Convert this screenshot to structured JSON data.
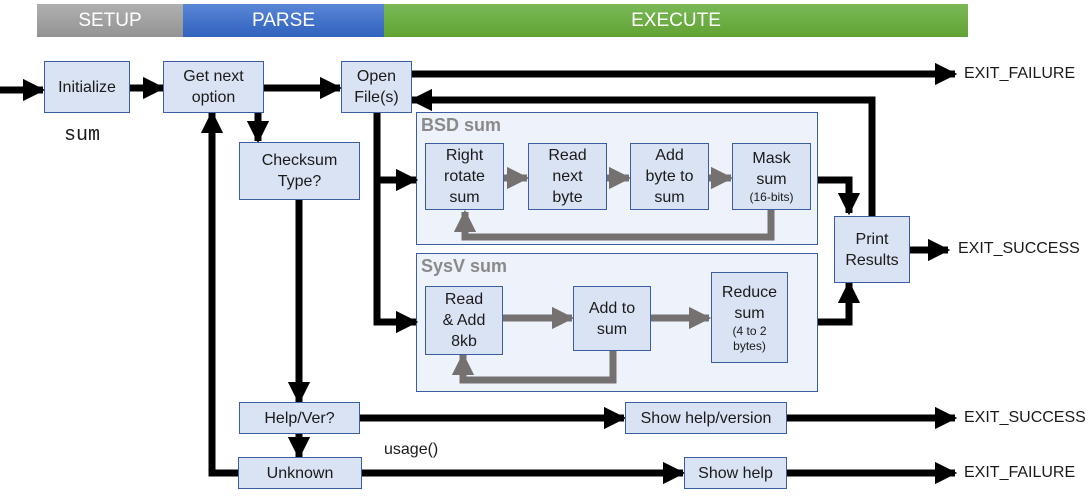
{
  "phases": [
    {
      "label": "SETUP",
      "color": "#a6a6a6"
    },
    {
      "label": "PARSE",
      "color": "#4472c4"
    },
    {
      "label": "EXECUTE",
      "color": "#70ad47"
    }
  ],
  "program_name": "sum",
  "nodes": {
    "initialize": "Initialize",
    "get_next_option": "Get next\noption",
    "open_files": "Open\nFile(s)",
    "checksum_type": "Checksum\nType?",
    "help_ver": "Help/Ver?",
    "unknown": "Unknown",
    "show_help_version": "Show help/version",
    "show_help": "Show help",
    "print_results": "Print\nResults"
  },
  "bsd_group": {
    "title": "BSD sum",
    "steps": [
      {
        "text": "Right\nrotate\nsum",
        "note": ""
      },
      {
        "text": "Read\nnext\nbyte",
        "note": ""
      },
      {
        "text": "Add\nbyte to\nsum",
        "note": ""
      },
      {
        "text": "Mask\nsum",
        "note": "(16-bits)"
      }
    ]
  },
  "sysv_group": {
    "title": "SysV sum",
    "steps": [
      {
        "text": "Read\n& Add\n8kb",
        "note": ""
      },
      {
        "text": "Add to\nsum",
        "note": ""
      },
      {
        "text": "Reduce\nsum",
        "note": "(4 to 2\nbytes)"
      }
    ]
  },
  "edge_labels": {
    "usage": "usage()"
  },
  "exits": {
    "open_failure": "EXIT_FAILURE",
    "print_success": "EXIT_SUCCESS",
    "help_success": "EXIT_SUCCESS",
    "unknown_failure": "EXIT_FAILURE"
  },
  "colors": {
    "box_fill": "#dae3f3",
    "box_border": "#3b5ea0",
    "group_fill": "#eef2fa",
    "inner_arrow": "#767171",
    "main_arrow": "#000000"
  }
}
